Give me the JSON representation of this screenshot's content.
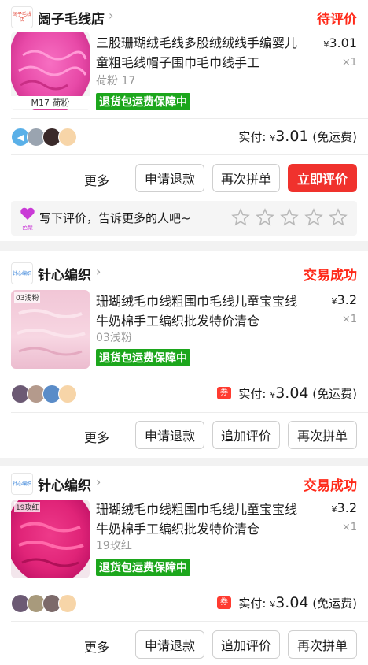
{
  "orders": [
    {
      "shop": {
        "name": "阔子毛线店",
        "logo_text": "阔子毛线店"
      },
      "status": "待评价",
      "product": {
        "title": "三股珊瑚绒毛线多股绒绒线手编婴儿童粗毛线帽子围巾毛巾线手工",
        "sku": "荷粉 17",
        "thumb_caption": "M17 荷粉",
        "badge": "退货包运费保障中",
        "currency": "¥",
        "price": "3.01",
        "qty": "×1"
      },
      "paid_label": "实付:",
      "paid_currency": "¥",
      "paid_amount": "3.01",
      "paid_note": "(免运费)",
      "actions": {
        "more": "更多",
        "b1": "申请退款",
        "b2": "再次拼单",
        "b3": "立即评价"
      },
      "review_prompt": "写下评价，告诉更多的人吧~",
      "review_icon_text": "芭聚",
      "star_count": 5
    },
    {
      "shop": {
        "name": "针心编织",
        "logo_text": "针心编织"
      },
      "status": "交易成功",
      "product": {
        "title": "珊瑚绒毛巾线粗围巾毛线儿童宝宝线牛奶棉手工编织批发特价清仓",
        "sku": "03浅粉",
        "thumb_label": "03浅粉",
        "badge": "退货包运费保障中",
        "currency": "¥",
        "price": "3.2",
        "qty": "×1"
      },
      "coupon_icon": "券",
      "paid_label": "实付:",
      "paid_currency": "¥",
      "paid_amount": "3.04",
      "paid_note": "(免运费)",
      "actions": {
        "more": "更多",
        "b1": "申请退款",
        "b2": "追加评价",
        "b3": "再次拼单"
      }
    },
    {
      "shop": {
        "name": "针心编织",
        "logo_text": "针心编织"
      },
      "status": "交易成功",
      "product": {
        "title": "珊瑚绒毛巾线粗围巾毛线儿童宝宝线牛奶棉手工编织批发特价清仓",
        "sku": "19玫红",
        "thumb_label": "19玫红",
        "badge": "退货包运费保障中",
        "currency": "¥",
        "price": "3.2",
        "qty": "×1"
      },
      "coupon_icon": "券",
      "paid_label": "实付:",
      "paid_currency": "¥",
      "paid_amount": "3.04",
      "paid_note": "(免运费)",
      "actions": {
        "more": "更多",
        "b1": "申请退款",
        "b2": "追加评价",
        "b3": "再次拼单"
      }
    }
  ],
  "colors": {
    "accent_red": "#ff2a1a",
    "button_red": "#f0322d",
    "badge_green": "#1ca61c",
    "star_outline": "#c8c8c8"
  }
}
